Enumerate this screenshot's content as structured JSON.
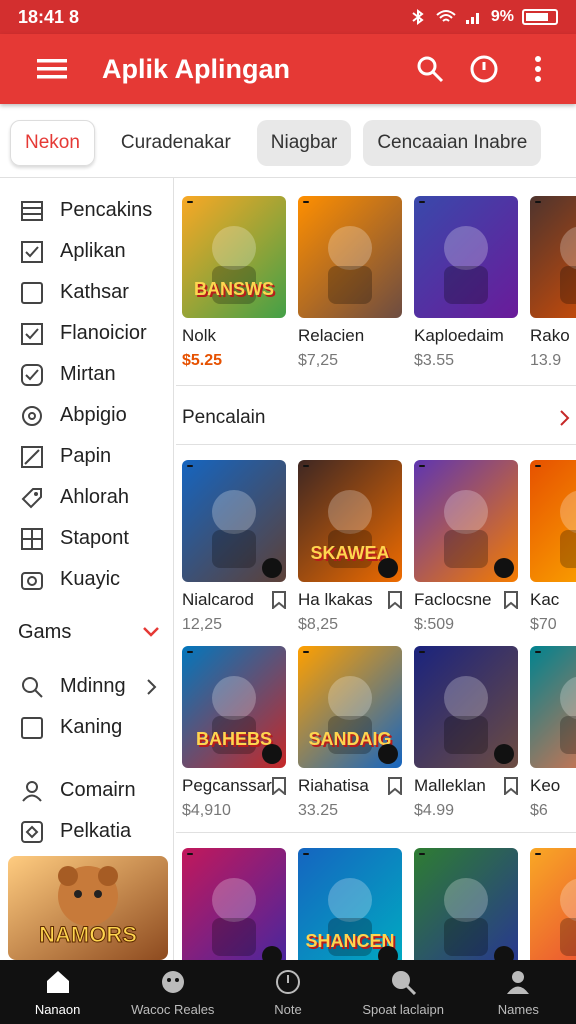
{
  "status": {
    "time": "18:41 8",
    "battery": "9%"
  },
  "appbar": {
    "title": "Aplik Aplingan",
    "icons": [
      "menu-icon",
      "search-icon",
      "clock-icon",
      "more-vert-icon"
    ]
  },
  "tabs": [
    {
      "label": "Nekon",
      "active": true
    },
    {
      "label": "Curadenakar"
    },
    {
      "label": "Niagbar"
    },
    {
      "label": "Cencaaian  Inabre"
    }
  ],
  "sidebar": {
    "items": [
      {
        "label": "Pencakins",
        "icon": "list-icon"
      },
      {
        "label": "Aplikan",
        "icon": "checkbox-icon"
      },
      {
        "label": "Kathsar",
        "icon": "square-icon"
      },
      {
        "label": "Flanoicior",
        "icon": "checkbox-icon"
      },
      {
        "label": "Mirtan",
        "icon": "check-circle-icon"
      },
      {
        "label": "Abpigio",
        "icon": "refresh-icon"
      },
      {
        "label": "Papin",
        "icon": "edit-icon"
      },
      {
        "label": "Ahlorah",
        "icon": "tag-icon"
      },
      {
        "label": "Stapont",
        "icon": "grid-icon"
      },
      {
        "label": "Kuayic",
        "icon": "camera-icon"
      }
    ],
    "group": {
      "label": "Gams"
    },
    "items2": [
      {
        "label": "Mdinng",
        "icon": "search-icon"
      },
      {
        "label": "Kaning",
        "icon": "square-icon"
      }
    ],
    "items3": [
      {
        "label": "Comairn",
        "icon": "user-icon"
      },
      {
        "label": "Pelkatia",
        "icon": "shield-icon"
      }
    ],
    "banner": {
      "text": "NAMORS"
    }
  },
  "main": {
    "row1": [
      {
        "name": "Nolk",
        "price": "$5.25",
        "art": "BANSWS",
        "c1": "#f9a825",
        "c2": "#43a047",
        "highlight": true
      },
      {
        "name": "Relacien",
        "price": "$7,25",
        "art": "",
        "c1": "#ff8f00",
        "c2": "#6d4c41"
      },
      {
        "name": "Kaploedaim",
        "price": "$3.55",
        "art": "",
        "c1": "#3949ab",
        "c2": "#6a1b9a"
      },
      {
        "name": "Rako",
        "price": "13.9",
        "art": "",
        "c1": "#4e342e",
        "c2": "#e65100"
      }
    ],
    "section": {
      "title": "Pencalain"
    },
    "row2": [
      {
        "name": "Nialcarod",
        "price": "12,25",
        "art": "",
        "c1": "#1565c0",
        "c2": "#5d4037"
      },
      {
        "name": "Ha lkakas",
        "price": "$8,25",
        "art": "SKAWEA",
        "c1": "#3e2723",
        "c2": "#ef6c00"
      },
      {
        "name": "Faclocsne",
        "price": "$:509",
        "art": "",
        "c1": "#5e35b1",
        "c2": "#f57c00"
      },
      {
        "name": "Kac",
        "price": "$70",
        "art": "",
        "c1": "#e65100",
        "c2": "#ffb300"
      }
    ],
    "row3": [
      {
        "name": "Pegcanssar",
        "price": "$4,910",
        "art": "BAHEBS",
        "c1": "#0277bd",
        "c2": "#c62828"
      },
      {
        "name": "Riahatisa",
        "price": "33.25",
        "art": "SANDAIG",
        "c1": "#ffa000",
        "c2": "#1565c0"
      },
      {
        "name": "Malleklan",
        "price": "$4.99",
        "art": "",
        "c1": "#1a237e",
        "c2": "#6d4c41"
      },
      {
        "name": "Keo",
        "price": "$6",
        "art": "",
        "c1": "#00838f",
        "c2": "#ff7043"
      }
    ],
    "row4": [
      {
        "name": "",
        "price": "",
        "art": "",
        "c1": "#c2185b",
        "c2": "#4527a0"
      },
      {
        "name": "",
        "price": "",
        "art": "SHANCEN",
        "c1": "#1565c0",
        "c2": "#00acc1"
      },
      {
        "name": "",
        "price": "",
        "art": "",
        "c1": "#2e7d32",
        "c2": "#283593"
      },
      {
        "name": "",
        "price": "",
        "art": "",
        "c1": "#f9a825",
        "c2": "#e53935"
      }
    ]
  },
  "navbar": [
    {
      "label": "Nanaon",
      "icon": "home-icon",
      "active": true
    },
    {
      "label": "Wacoc Reales",
      "icon": "face-icon"
    },
    {
      "label": "Note",
      "icon": "clock-icon"
    },
    {
      "label": "Spoat laclaipn",
      "icon": "search-icon"
    },
    {
      "label": "Names",
      "icon": "person-icon"
    }
  ],
  "colors": {
    "primary": "#e53935",
    "status": "#d32f2f"
  }
}
